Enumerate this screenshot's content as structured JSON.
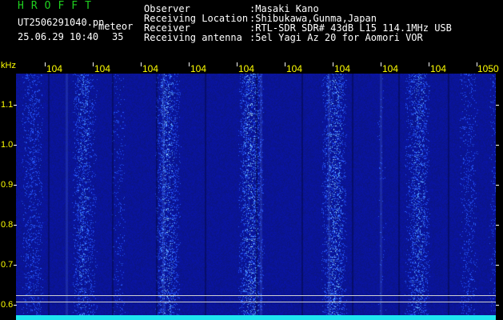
{
  "header": {
    "brand": "HROFFT",
    "filename": "UT2506291040.pn",
    "tag": "meteor",
    "datetime": "25.06.29 10:40",
    "count": "35",
    "fields": [
      {
        "label": "Observer",
        "value": ":Masaki Kano"
      },
      {
        "label": "Receiving Location",
        "value": ":Shibukawa,Gunma,Japan"
      },
      {
        "label": "Receiver",
        "value": ":RTL-SDR SDR# 43dB L15 114.1MHz USB"
      },
      {
        "label": "Receiving antenna",
        "value": ":5el Yagi Az 20 for Aomori VOR"
      }
    ]
  },
  "axis": {
    "unit": "kHz",
    "x_ticks": [
      "104",
      "104",
      "104",
      "104",
      "104",
      "104",
      "104",
      "104",
      "104",
      "1050"
    ],
    "y_ticks": [
      "1.1",
      "1.0",
      "0.9",
      "0.8",
      "0.7",
      "0.6"
    ]
  },
  "colors": {
    "background": "#000000",
    "plot": "#0c1a9e",
    "speckle": "#3f7cff",
    "label": "#ffff00",
    "brand": "#1fd11f",
    "baseline": "#1ee6f0"
  }
}
